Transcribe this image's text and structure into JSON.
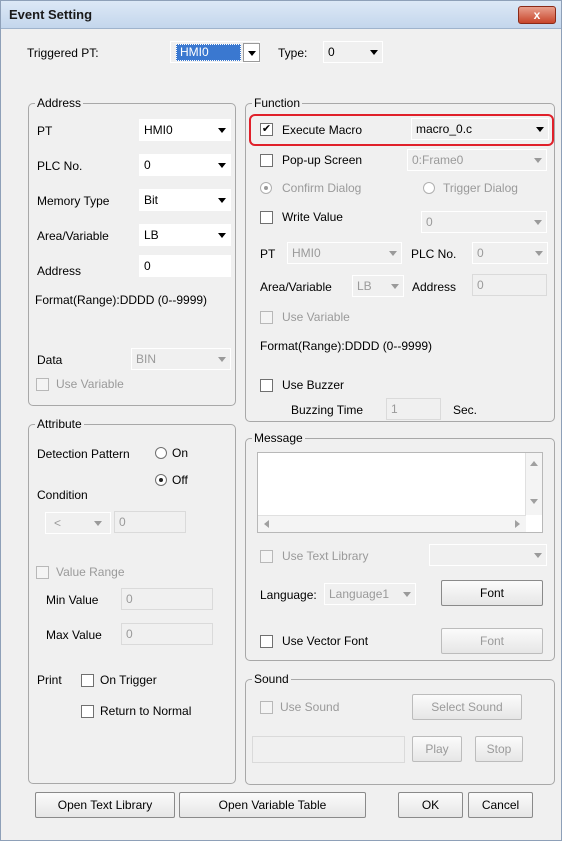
{
  "window": {
    "title": "Event Setting",
    "close_label": "x"
  },
  "top": {
    "triggered_pt_label": "Triggered PT:",
    "triggered_pt_value": "HMI0",
    "type_label": "Type:",
    "type_value": "0"
  },
  "address": {
    "title": "Address",
    "pt_label": "PT",
    "pt_value": "HMI0",
    "plc_label": "PLC No.",
    "plc_value": "0",
    "memory_label": "Memory Type",
    "memory_value": "Bit",
    "area_label": "Area/Variable",
    "area_value": "LB",
    "address_label": "Address",
    "address_value": "0",
    "format_text": "Format(Range):DDDD (0--9999)",
    "data_label": "Data",
    "data_value": "BIN",
    "use_variable_label": "Use Variable"
  },
  "attribute": {
    "title": "Attribute",
    "detection_label": "Detection Pattern",
    "on_label": "On",
    "off_label": "Off",
    "condition_label": "Condition",
    "cond_op": "<",
    "cond_value": "0",
    "value_range_label": "Value Range",
    "min_label": "Min Value",
    "min_value": "0",
    "max_label": "Max Value",
    "max_value": "0",
    "print_label": "Print",
    "on_trigger_label": "On Trigger",
    "return_normal_label": "Return to Normal"
  },
  "function": {
    "title": "Function",
    "execute_macro_label": "Execute Macro",
    "execute_macro_value": "macro_0.c",
    "popup_label": "Pop-up Screen",
    "popup_value": "0:Frame0",
    "confirm_label": "Confirm Dialog",
    "trigger_label": "Trigger Dialog",
    "write_value_label": "Write Value",
    "write_value_value": "0",
    "pt_label": "PT",
    "pt_value": "HMI0",
    "plc_label": "PLC No.",
    "plc_value": "0",
    "area_label": "Area/Variable",
    "area_value": "LB",
    "address_label": "Address",
    "address_value": "0",
    "use_variable_label": "Use Variable",
    "format_text": "Format(Range):DDDD (0--9999)",
    "use_buzzer_label": "Use Buzzer",
    "buzzing_label": "Buzzing Time",
    "buzzing_value": "1",
    "sec_label": "Sec."
  },
  "message": {
    "title": "Message",
    "use_text_library_label": "Use Text Library",
    "language_label": "Language:",
    "language_value": "Language1",
    "font_label": "Font",
    "use_vector_font_label": "Use Vector Font",
    "font2_label": "Font"
  },
  "sound": {
    "title": "Sound",
    "use_sound_label": "Use Sound",
    "select_sound_label": "Select Sound",
    "play_label": "Play",
    "stop_label": "Stop"
  },
  "footer": {
    "open_text_library": "Open Text Library",
    "open_variable_table": "Open Variable Table",
    "ok": "OK",
    "cancel": "Cancel"
  },
  "state": {
    "execute_macro_checked": "✔"
  }
}
